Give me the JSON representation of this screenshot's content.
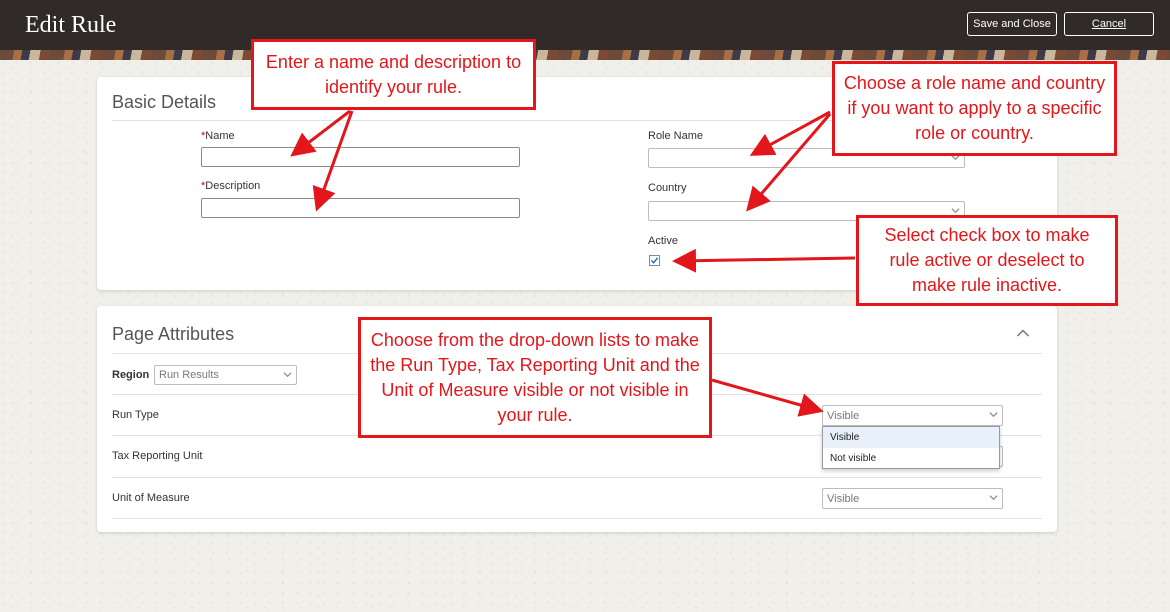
{
  "header": {
    "title": "Edit Rule",
    "save_close_label": "Save and Close",
    "cancel_label": "Cancel"
  },
  "basic_details": {
    "section_title": "Basic Details",
    "name_label": "Name",
    "name_required": "*",
    "description_label": "Description",
    "description_required": "*",
    "role_name_label": "Role Name",
    "country_label": "Country",
    "active_label": "Active",
    "active_checked": true
  },
  "page_attributes": {
    "section_title": "Page Attributes",
    "region_label": "Region",
    "region_value": "Run Results",
    "rows": [
      {
        "label": "Run Type",
        "value": "Visible"
      },
      {
        "label": "Tax Reporting Unit",
        "value": ""
      },
      {
        "label": "Unit of Measure",
        "value": "Visible"
      }
    ],
    "dropdown_options": [
      "Visible",
      "Not visible"
    ]
  },
  "callouts": {
    "name_desc": "Enter a name and description to identify your rule.",
    "role_country": "Choose a role name and country if you want to apply to a specific role or country.",
    "active": "Select check box to make rule active or deselect to make rule inactive.",
    "dropdowns": "Choose from the drop-down lists to make the Run Type, Tax Reporting Unit and the Unit of Measure visible or not visible in your rule."
  },
  "colors": {
    "header_bg": "#302b28",
    "callout_red": "#e3161b",
    "checkbox_blue": "#1e6fc9"
  }
}
